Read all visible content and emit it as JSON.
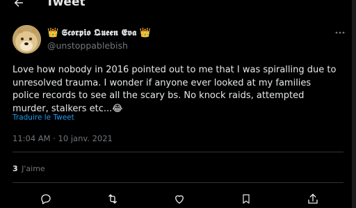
{
  "header": {
    "title": "Tweet"
  },
  "tweet": {
    "display_name": "𝕾𝖈𝖔𝖗𝖕𝖎𝖔 𝕼𝖚𝖊𝖊𝖓 𝕰𝖛𝖆",
    "crown_left": "👑",
    "crown_right": "👑",
    "handle": "@unstoppablebish",
    "text": "Love how nobody in 2016 pointed out to me that I was spiralling due to unresolved trauma. I wonder if anyone ever looked at my families police records to see all the scary bs. No knock raids, attempted murder, stalkers etc...😂",
    "translate_label": "Traduire le Tweet",
    "timestamp": "11:04 AM · 10 janv. 2021",
    "likes_count": "3",
    "likes_label": "J'aime"
  },
  "icons": [
    "back-arrow-icon",
    "more-icon",
    "reply-icon",
    "retweet-icon",
    "like-icon",
    "bookmark-icon",
    "share-icon"
  ]
}
